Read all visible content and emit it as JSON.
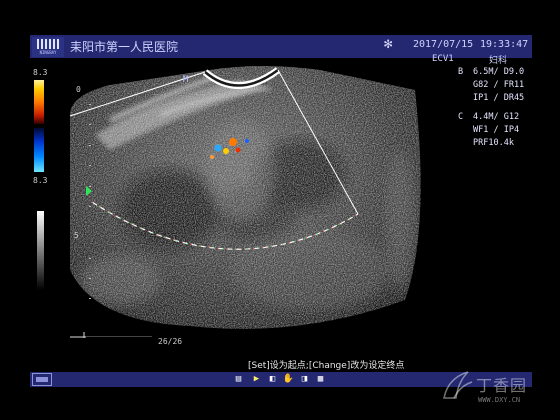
{
  "header": {
    "logo_text": "NINGBAY",
    "hospital_name": "耒阳市第一人民医院",
    "date": "2017/07/15",
    "time": "19:33:47",
    "probe": "ECV1",
    "department": "妇科"
  },
  "params": {
    "rows": [
      {
        "lead": "B",
        "text": "6.5M/ D9.0"
      },
      {
        "lead": "",
        "text": "G82 / FR11"
      },
      {
        "lead": "",
        "text": "IP1 / DR45"
      },
      {
        "lead": "C",
        "text": "4.4M/ G12"
      },
      {
        "lead": "",
        "text": "WF1 / IP4"
      },
      {
        "lead": "",
        "text": "PRF10.4k"
      }
    ]
  },
  "color_scale": {
    "top": "8.3",
    "bottom": "8.3"
  },
  "depth_labels": {
    "zero": "0",
    "five": "5"
  },
  "frame_counter": "26/26",
  "status_message": "[Set]设为起点;[Change]改为设定终点",
  "watermark": {
    "text": "丁香园",
    "url": "WWW.DXY.CN"
  },
  "colors": {
    "bar_bg": "#232870",
    "fan_outline": "#ffffff",
    "doppler_warm": "#ff7a00",
    "doppler_cool": "#0088ff"
  },
  "toolbar_icons": [
    "report-icon",
    "cursor-icon",
    "flip-icon",
    "hand-icon",
    "camera-icon",
    "multi-view-icon"
  ]
}
